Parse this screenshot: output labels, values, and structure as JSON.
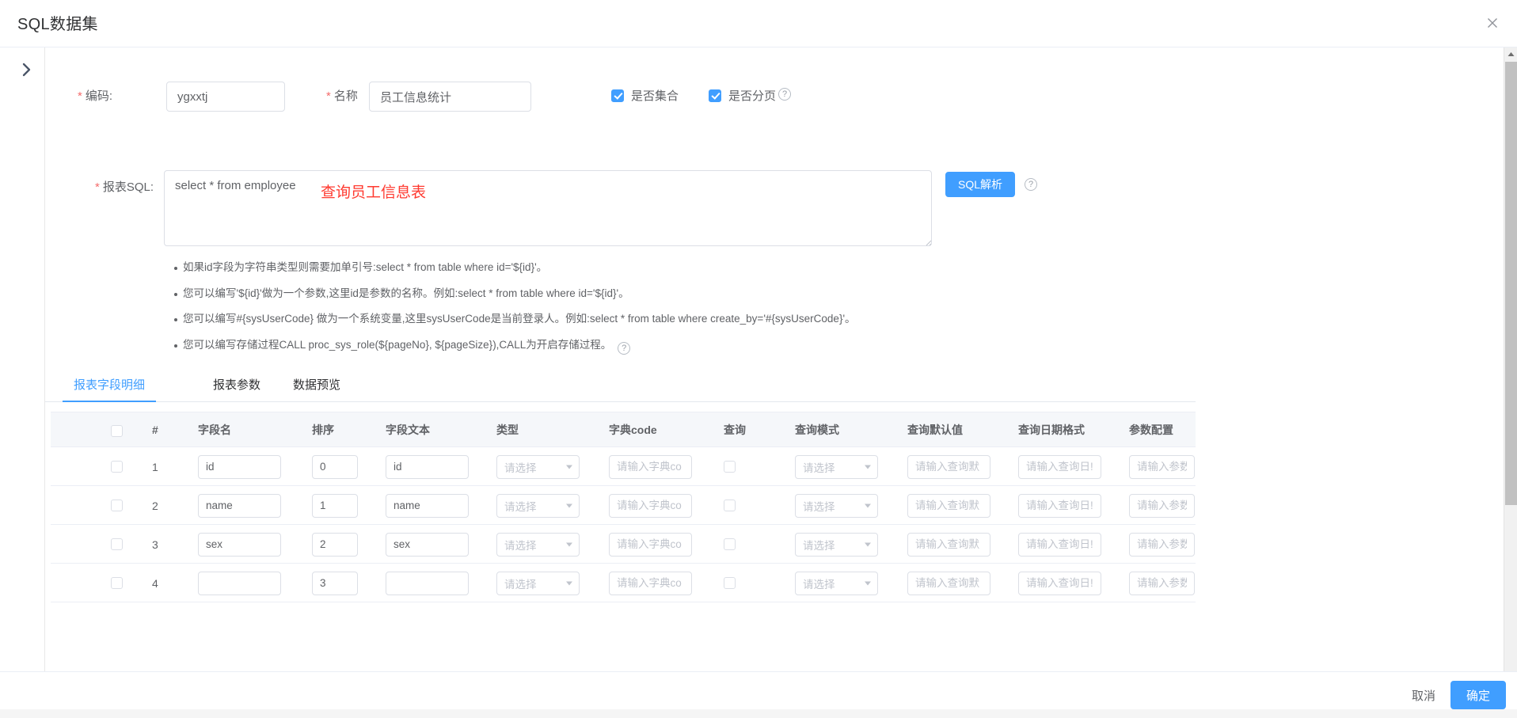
{
  "dialog": {
    "title": "SQL数据集",
    "close_icon": "close-icon",
    "collapse_icon": "chevron-right-icon"
  },
  "form": {
    "code": {
      "label": "编码:",
      "value": "ygxxtj",
      "required": true
    },
    "name": {
      "label": "名称",
      "value": "员工信息统计",
      "required": true
    },
    "is_collection": {
      "label": "是否集合",
      "checked": true
    },
    "is_paging": {
      "label": "是否分页",
      "checked": true,
      "help_icon": "question-circle-icon"
    },
    "sql": {
      "label": "报表SQL:",
      "value": "select * from employee",
      "required": true,
      "annotation": "查询员工信息表",
      "parse_button": "SQL解析",
      "parse_help_icon": "question-circle-icon"
    }
  },
  "tips": [
    {
      "text": "如果id字段为字符串类型则需要加单引号:select * from table where id='${id}'。",
      "help": false
    },
    {
      "text": "您可以编写'${id}'做为一个参数,这里id是参数的名称。例如:select * from table where id='${id}'。",
      "help": false
    },
    {
      "text": "您可以编写#{sysUserCode} 做为一个系统变量,这里sysUserCode是当前登录人。例如:select * from table where create_by='#{sysUserCode}'。",
      "help": false
    },
    {
      "text": "您可以编写存储过程CALL proc_sys_role(${pageNo}, ${pageSize}),CALL为开启存储过程。",
      "help": true
    }
  ],
  "tabs": [
    {
      "label": "报表字段明细",
      "active": true
    },
    {
      "label": "报表参数",
      "active": false
    },
    {
      "label": "数据预览",
      "active": false
    }
  ],
  "table": {
    "columns": [
      "#",
      "字段名",
      "排序",
      "字段文本",
      "类型",
      "字典code",
      "查询",
      "查询模式",
      "查询默认值",
      "查询日期格式",
      "参数配置"
    ],
    "placeholders": {
      "type": "请选择",
      "dict_code": "请输入字典co",
      "query_mode": "请选择",
      "query_default": "请输入查询默",
      "query_date_format": "请输入查询日!",
      "param_config": "请输入参数"
    },
    "rows": [
      {
        "index": "1",
        "field_name": "id",
        "sort": "0",
        "field_text": "id",
        "checked": false
      },
      {
        "index": "2",
        "field_name": "name",
        "sort": "1",
        "field_text": "name",
        "checked": false
      },
      {
        "index": "3",
        "field_name": "sex",
        "sort": "2",
        "field_text": "sex",
        "checked": false
      },
      {
        "index": "4",
        "field_name": "",
        "sort": "3",
        "field_text": "",
        "checked": false
      }
    ]
  },
  "footer": {
    "cancel": "取消",
    "confirm": "确定"
  },
  "colors": {
    "primary": "#409eff",
    "required": "#f56c6c",
    "annotation": "#ff3a30",
    "text": "#606266",
    "header_bg": "#f5f7fa"
  }
}
